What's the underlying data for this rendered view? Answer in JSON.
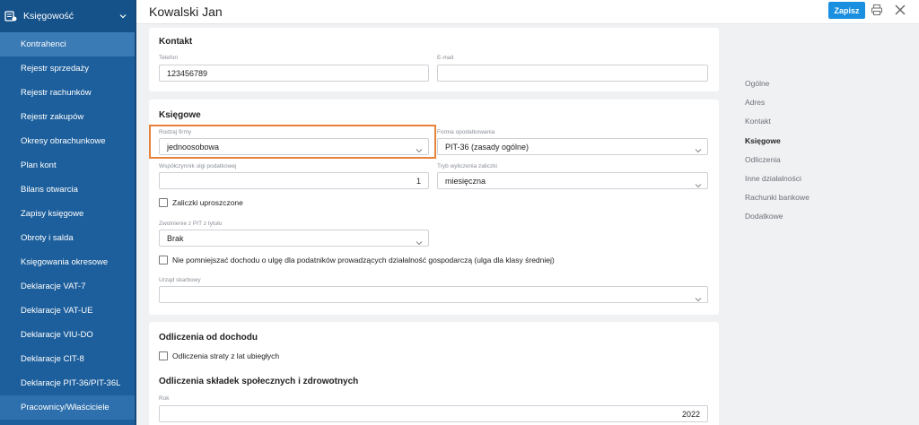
{
  "sidebar": {
    "section_label": "Księgowość",
    "items": [
      {
        "label": "Kontrahenci"
      },
      {
        "label": "Rejestr sprzedaży"
      },
      {
        "label": "Rejestr rachunków"
      },
      {
        "label": "Rejestr zakupów"
      },
      {
        "label": "Okresy obrachunkowe"
      },
      {
        "label": "Plan kont"
      },
      {
        "label": "Bilans otwarcia"
      },
      {
        "label": "Zapisy księgowe"
      },
      {
        "label": "Obroty i salda"
      },
      {
        "label": "Księgowania okresowe"
      },
      {
        "label": "Deklaracje VAT-7"
      },
      {
        "label": "Deklaracje VAT-UE"
      },
      {
        "label": "Deklaracje VIU-DO"
      },
      {
        "label": "Deklaracje CIT-8"
      },
      {
        "label": "Deklaracje PIT-36/PIT-36L"
      },
      {
        "label": "Pracownicy/Właściciele"
      }
    ]
  },
  "header": {
    "title": "Kowalski Jan",
    "save_label": "Zapisz"
  },
  "kontakt": {
    "title": "Kontakt",
    "phone_label": "Telefon",
    "phone_value": "123456789",
    "email_label": "E-mail",
    "email_value": ""
  },
  "ksiegowe": {
    "title": "Księgowe",
    "firm_type_label": "Rodzaj firmy",
    "firm_type_value": "jednoosobowa",
    "tax_form_label": "Forma opodatkowania",
    "tax_form_value": "PIT-36 (zasady ogólne)",
    "relief_label": "Współczynnik ulgi podatkowej",
    "relief_value": "1",
    "advance_mode_label": "Tryb wyliczenia zaliczki",
    "advance_mode_value": "miesięczna",
    "simplified_label": "Zaliczki uproszczone",
    "pit_exempt_label": "Zwolnienie z PIT z tytułu",
    "pit_exempt_value": "Brak",
    "no_reduce_label": "Nie pomniejszać dochodu o ulgę dla podatników prowadzących działalność gospodarczą (ulga dla klasy średniej)",
    "tax_office_label": "Urząd skarbowy",
    "tax_office_value": ""
  },
  "odliczenia": {
    "title": "Odliczenia od dochodu",
    "loss_label": "Odliczenia straty z lat ubiegłych",
    "social_title": "Odliczenia składek społecznych i zdrowotnych",
    "year_label": "Rok",
    "year_value": "2022"
  },
  "right_nav": {
    "items": [
      {
        "label": "Ogólne"
      },
      {
        "label": "Adres"
      },
      {
        "label": "Kontakt"
      },
      {
        "label": "Księgowe"
      },
      {
        "label": "Odliczenia"
      },
      {
        "label": "Inne działalności"
      },
      {
        "label": "Rachunki bankowe"
      },
      {
        "label": "Dodatkowe"
      }
    ]
  },
  "colors": {
    "sidebar": "#1d5f9c",
    "accent": "#1a8fe0",
    "highlight": "#e8823a"
  }
}
